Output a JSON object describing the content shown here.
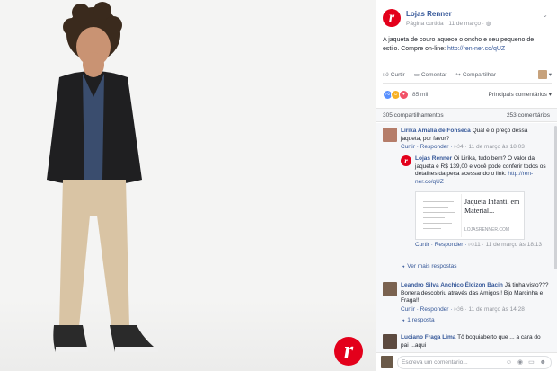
{
  "brand": {
    "logo_letter": "r",
    "color": "#e3001b"
  },
  "post": {
    "page_name": "Lojas Renner",
    "meta": "Página curtida · 11 de março · ",
    "text": "A jaqueta de couro aquece o oncho e seu pequeno de estilo. Compre on-line: ",
    "link": "http://ren-ner.co/qUZ",
    "actions": {
      "like": "Curtir",
      "comment": "Comentar",
      "share": "Compartilhar"
    },
    "reactions_count": "85 mil",
    "sort_label": "Principais comentários ▾",
    "shares": "305 compartilhamentos",
    "comments_count": "253 comentários"
  },
  "comments": [
    {
      "name": "Lirika Amália de Fonseca",
      "text": "Qual é o preço dessa jaqueta, por favor?",
      "actions": "Curtir · Responder · ",
      "likes": "4",
      "time": " · 11 de março às 18:03"
    },
    {
      "name": "Leandro Silva Anchico Ëlcizon Bacin",
      "text": "Já tinha visto??? Bonera descobriu através das Amigos!! Bjo Marcinha e Fraga!!!",
      "actions": "Curtir · Responder · ",
      "likes": "6",
      "time": " · 11 de março às 14:28",
      "replies": "↳ 1 resposta"
    },
    {
      "name": "Luciano Fraga Lima",
      "text": "Tô boquiaberto que ... a cara do pai ...aqui"
    }
  ],
  "reply": {
    "name": "Lojas Renner",
    "text": "Oi Lirika, tudo bem? O valor da jaqueta é R$ 139,00 e você pode conferir todos os detalhes da peça acessando o link: ",
    "link": "http://ren-ner.co/qUZ",
    "card_title": "Jaqueta Infantil em Material...",
    "card_domain": "LOJASRENNER.COM",
    "actions": "Curtir · Responder · ",
    "likes": "11",
    "time": " · 11 de março às 18:13",
    "more": "↳ Ver mais respostas"
  },
  "composer": {
    "placeholder": "Escreva um comentário...",
    "icons": "☺ ◉ ▭ ☻"
  }
}
